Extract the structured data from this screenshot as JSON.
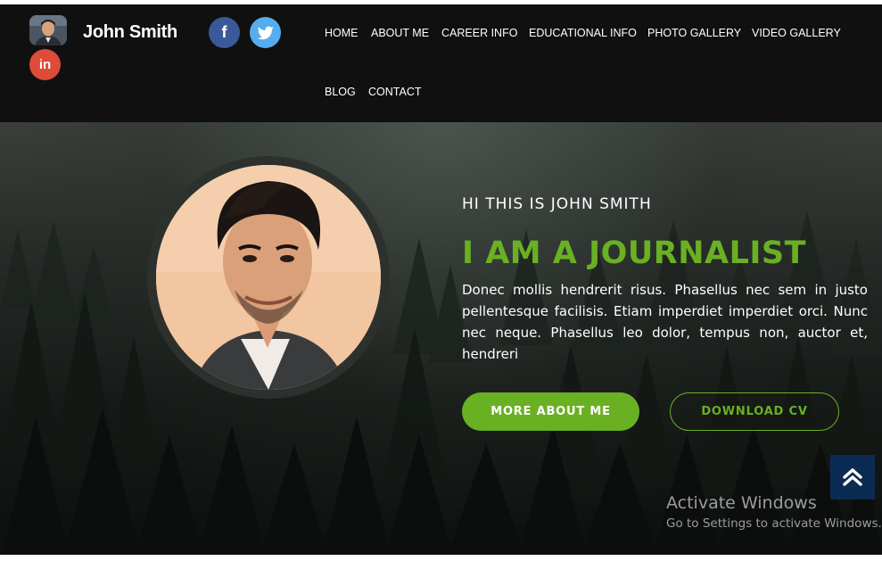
{
  "brand": {
    "name": "John Smith",
    "avatar_icon": "user-avatar"
  },
  "social": {
    "facebook": {
      "label": "f",
      "color": "#3b5998"
    },
    "twitter": {
      "icon": "twitter-bird-icon",
      "color": "#55acee"
    },
    "linkedin": {
      "label": "in",
      "color": "#dd4b39"
    }
  },
  "nav": {
    "items": [
      {
        "label": "HOME"
      },
      {
        "label": "ABOUT ME"
      },
      {
        "label": "CAREER INFO"
      },
      {
        "label": "EDUCATIONAL INFO"
      },
      {
        "label": "PHOTO GALLERY"
      },
      {
        "label": "VIDEO GALLERY"
      },
      {
        "label": "BLOG"
      },
      {
        "label": "CONTACT"
      }
    ]
  },
  "hero": {
    "greeting": "HI THIS IS JOHN SMITH",
    "headline": "I AM A JOURNALIST",
    "intro": "Donec mollis hendrerit risus. Phasellus nec sem in justo pellentesque facilisis. Etiam imperdiet imperdiet orci. Nunc nec neque. Phasellus leo dolor, tempus non, auctor et, hendreri",
    "primary_button": "MORE ABOUT ME",
    "secondary_button": "DOWNLOAD CV",
    "portrait_icon": "profile-portrait"
  },
  "scroll_top": {
    "icon": "double-chevron-up-icon"
  },
  "os_watermark": {
    "title": "Activate Windows",
    "subtitle": "Go to Settings to activate Windows."
  },
  "colors": {
    "accent": "#6ab023",
    "navbar": "#101010",
    "scroll_button": "#0c2b52"
  }
}
